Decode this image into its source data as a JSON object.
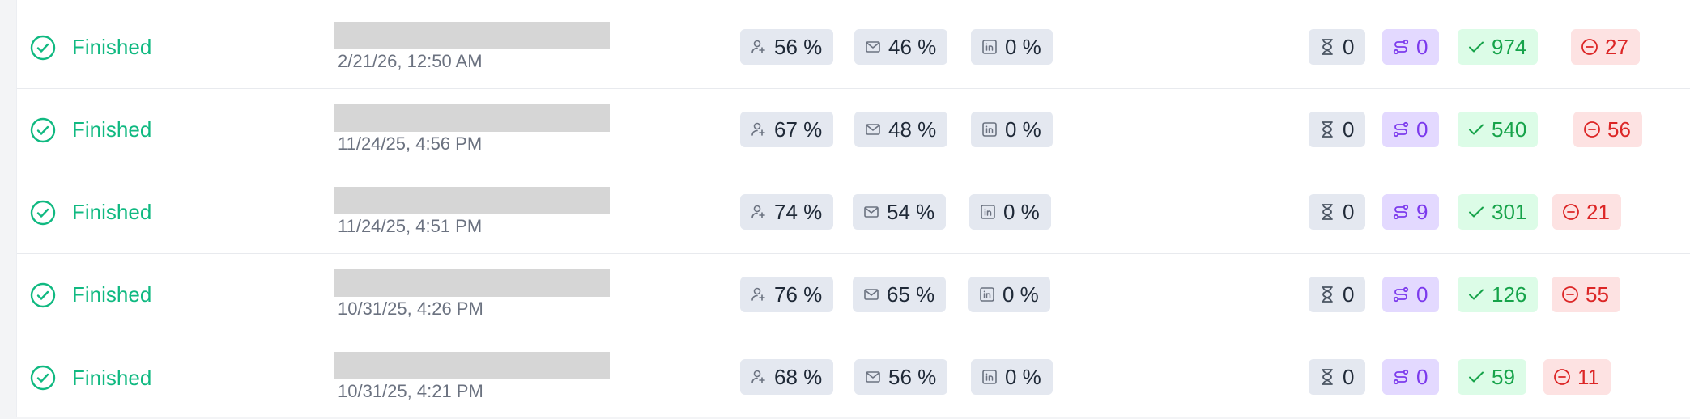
{
  "rows": [
    {
      "status": "Finished",
      "date": "2/21/26, 12:50 AM",
      "leads_pct": "56 %",
      "email_pct": "46 %",
      "linkedin_pct": "0 %",
      "waiting": "0",
      "in_progress": "0",
      "done": "974",
      "failed": "27"
    },
    {
      "status": "Finished",
      "date": "11/24/25, 4:56 PM",
      "leads_pct": "67 %",
      "email_pct": "48 %",
      "linkedin_pct": "0 %",
      "waiting": "0",
      "in_progress": "0",
      "done": "540",
      "failed": "56"
    },
    {
      "status": "Finished",
      "date": "11/24/25, 4:51 PM",
      "leads_pct": "74 %",
      "email_pct": "54 %",
      "linkedin_pct": "0 %",
      "waiting": "0",
      "in_progress": "9",
      "done": "301",
      "failed": "21"
    },
    {
      "status": "Finished",
      "date": "10/31/25, 4:26 PM",
      "leads_pct": "76 %",
      "email_pct": "65 %",
      "linkedin_pct": "0 %",
      "waiting": "0",
      "in_progress": "0",
      "done": "126",
      "failed": "55"
    },
    {
      "status": "Finished",
      "date": "10/31/25, 4:21 PM",
      "leads_pct": "68 %",
      "email_pct": "56 %",
      "linkedin_pct": "0 %",
      "waiting": "0",
      "in_progress": "0",
      "done": "59",
      "failed": "11"
    }
  ],
  "colors": {
    "finished": "#10b981",
    "gray_badge": "#e4e8f0",
    "purple_badge": "#e3d9ff",
    "green_badge": "#dcfce7",
    "red_badge": "#fde2e2"
  },
  "icons": {
    "status": "check-circle-icon",
    "leads": "user-plus-icon",
    "email": "mail-icon",
    "linkedin": "linkedin-icon",
    "waiting": "hourglass-icon",
    "in_progress": "route-icon",
    "done": "check-icon",
    "failed": "minus-circle-icon"
  }
}
